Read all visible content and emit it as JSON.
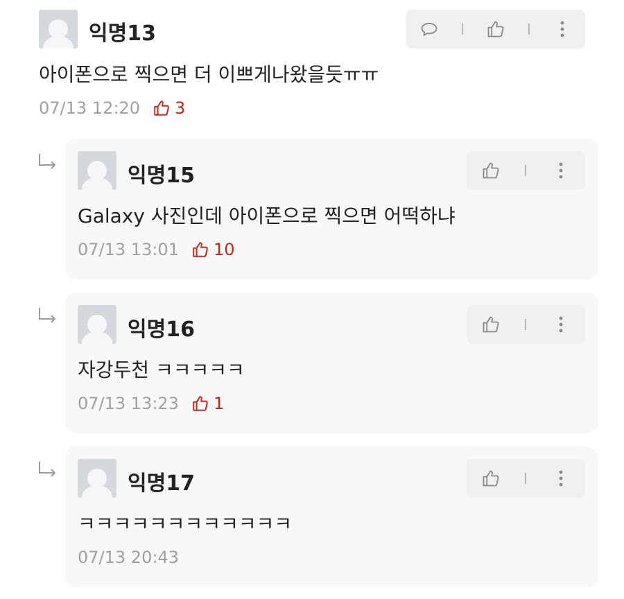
{
  "comments": [
    {
      "author": "익명13",
      "text": "아이폰으로 찍으면 더 이쁘게나왔을듯ㅠㅠ",
      "date": "07/13 12:20",
      "likes": "3"
    }
  ],
  "replies": [
    {
      "author": "익명15",
      "text": "Galaxy 사진인데 아이폰으로 찍으면 어떡하냐",
      "date": "07/13 13:01",
      "likes": "10"
    },
    {
      "author": "익명16",
      "text": "자강두천 ㅋㅋㅋㅋㅋ",
      "date": "07/13 13:23",
      "likes": "1"
    },
    {
      "author": "익명17",
      "text": "ㅋㅋㅋㅋㅋㅋㅋㅋㅋㅋㅋㅋ",
      "date": "07/13 20:43"
    }
  ],
  "icons": {
    "comment": "speech-bubble-icon",
    "like": "thumbs-up-icon",
    "more": "more-vertical-icon",
    "reply_arrow": "reply-arrow-icon"
  },
  "colors": {
    "like_count": "#c8261b",
    "meta_text": "#a0a0a0",
    "reply_background": "#f8f8f8",
    "action_background": "#f0f0f0"
  }
}
